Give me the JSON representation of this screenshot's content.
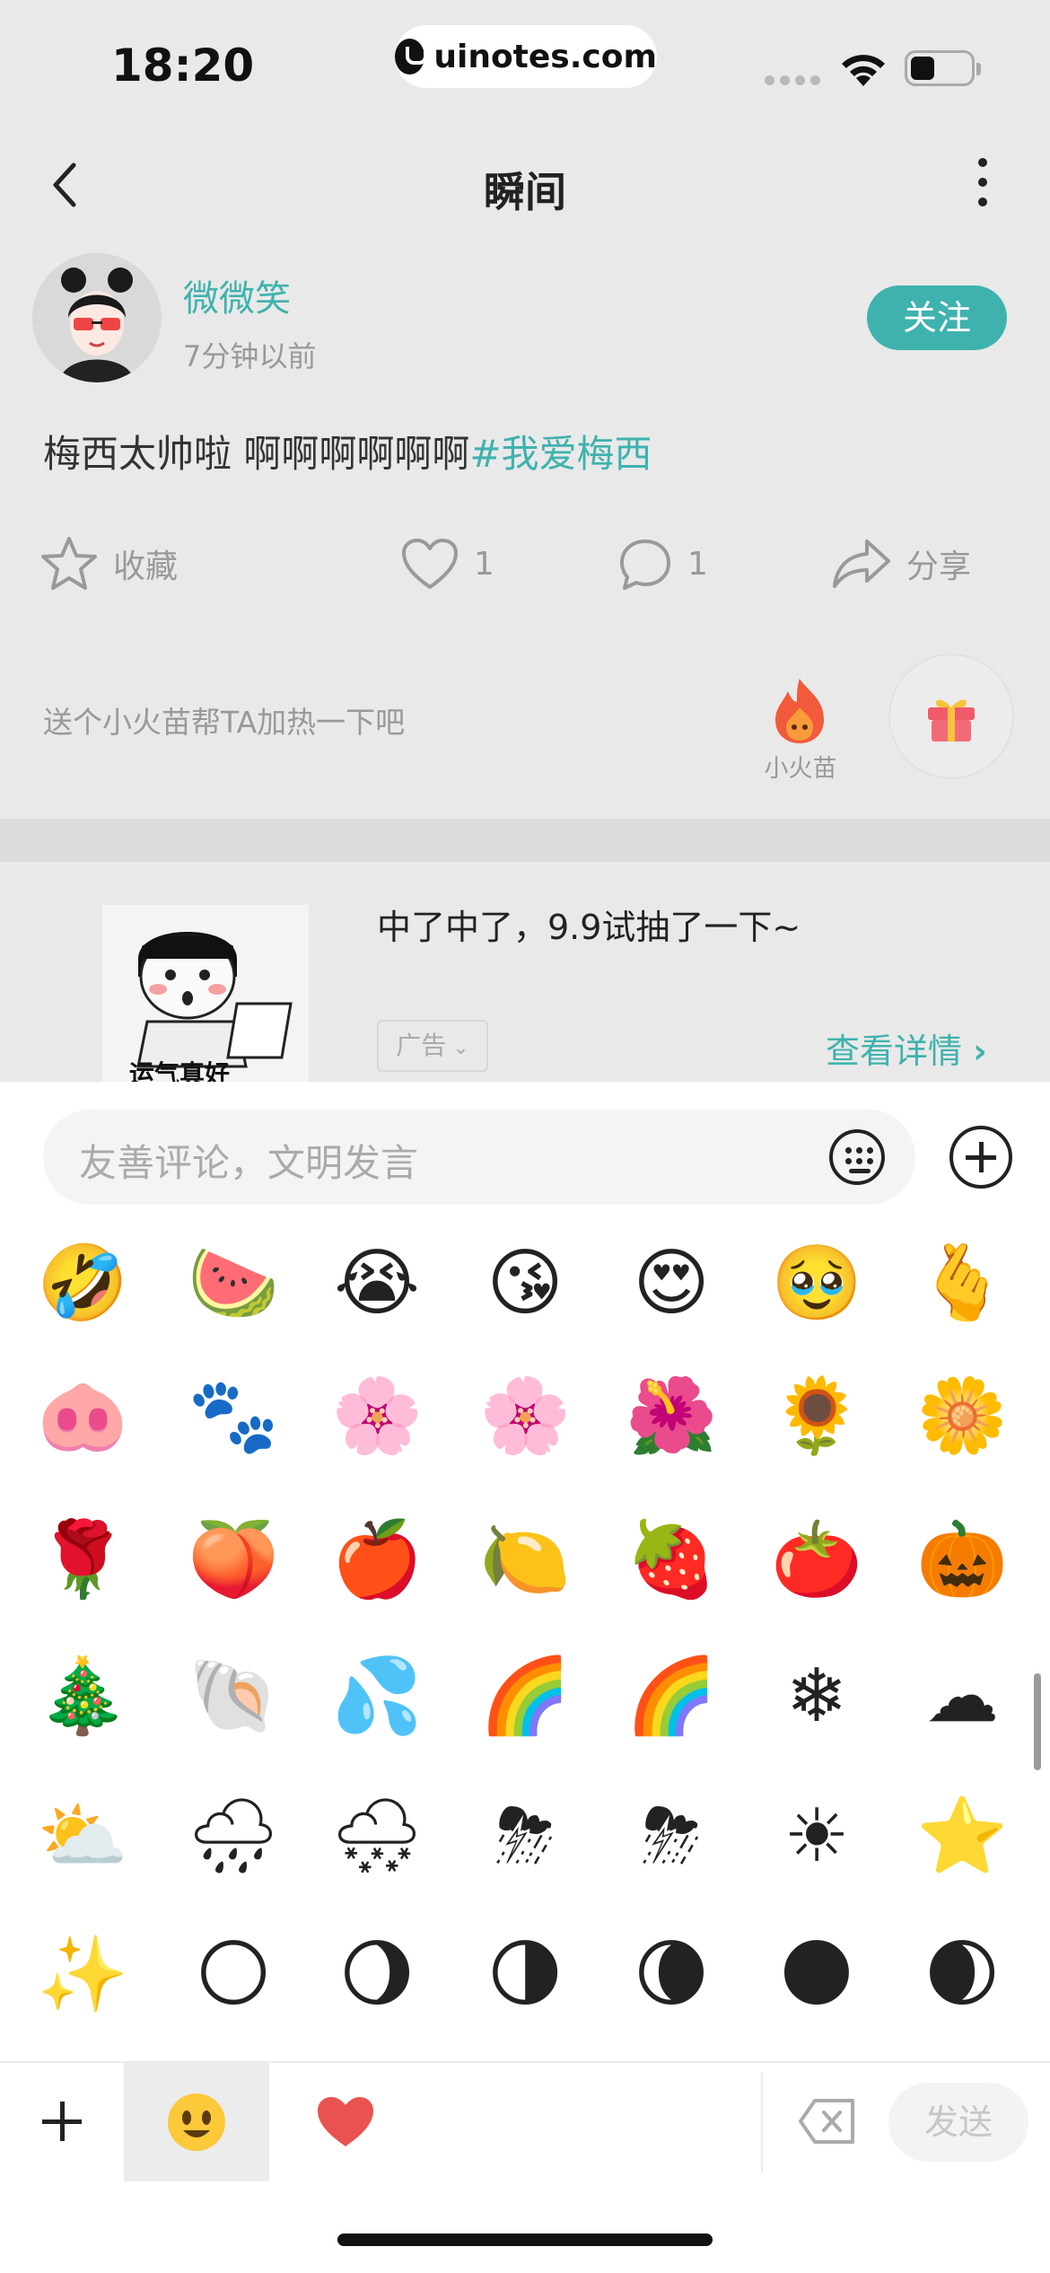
{
  "status_bar": {
    "time": "18:20",
    "url": "uinotes.com"
  },
  "nav": {
    "title": "瞬间"
  },
  "post": {
    "username": "微微笑",
    "time_ago": "7分钟以前",
    "follow_label": "关注",
    "text_main": "梅西太帅啦 啊啊啊啊啊啊",
    "hashtag": "#我爱梅西",
    "actions": {
      "favorite_label": "收藏",
      "like_count": "1",
      "comment_count": "1",
      "share_label": "分享"
    },
    "heat_prompt": "送个小火苗帮TA加热一下吧",
    "flame_label": "小火苗"
  },
  "ad": {
    "title": "中了中了，9.9试抽了一下~",
    "badge": "广告",
    "link_label": "查看详情",
    "image_caption": "运气真好"
  },
  "comment": {
    "placeholder": "友善评论，文明发言",
    "send_label": "发送"
  },
  "emoji_rows": [
    [
      "🤣",
      "🍉",
      "😭",
      "😘",
      "😍",
      "🥹",
      "🫰"
    ],
    [
      "🐽",
      "🐾",
      "🌸",
      "🌸",
      "🌺",
      "🌻",
      "🌼"
    ],
    [
      "🌹",
      "🍑",
      "🍎",
      "🍋",
      "🍓",
      "🍅",
      "🎃"
    ],
    [
      "🎄",
      "🐚",
      "💦",
      "🌈",
      "🌈",
      "❄",
      "☁"
    ],
    [
      "⛅",
      "🌧",
      "🌨",
      "⛈",
      "⛈",
      "☀",
      "⭐"
    ],
    [
      "✨",
      "🌕",
      "🌖",
      "🌗",
      "🌘",
      "🌑",
      "🌒"
    ]
  ],
  "colors": {
    "accent": "#3fb2ae",
    "dim_bg": "#e9e9e9",
    "heart": "#e9524f"
  }
}
